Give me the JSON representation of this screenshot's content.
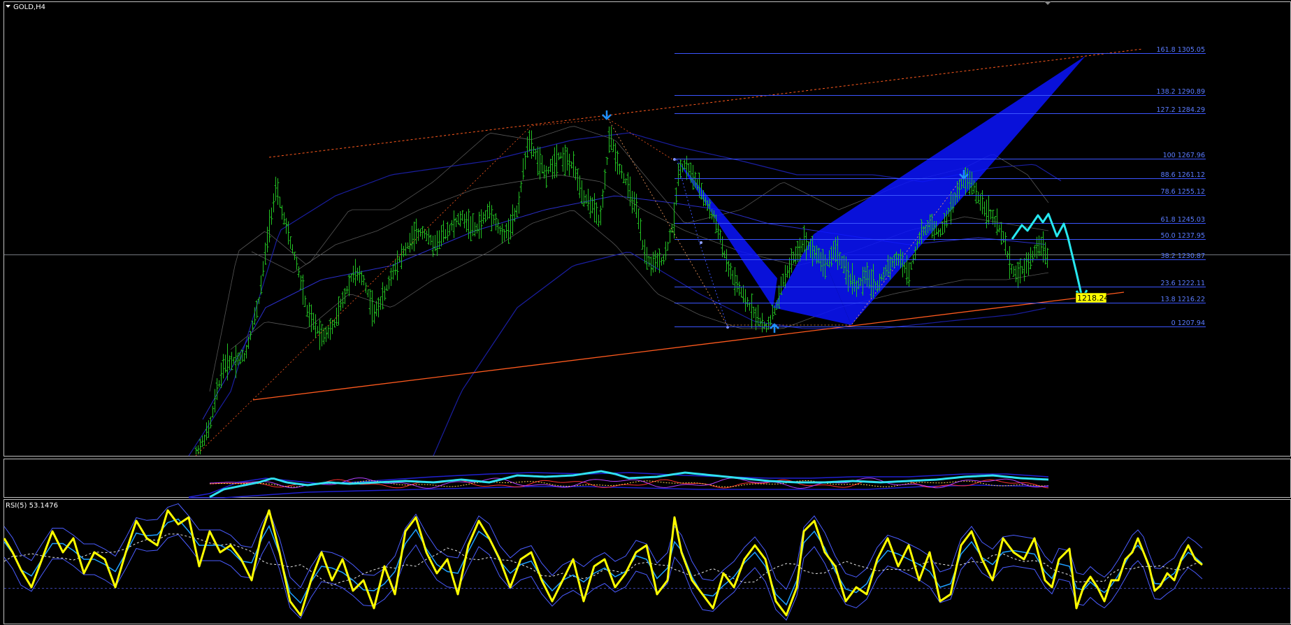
{
  "window": {
    "symbol_label": "GOLD,H4",
    "collapse_icon": "triangle-down-icon"
  },
  "colors": {
    "background": "#000000",
    "border": "#c0c0c0",
    "bull_bar": "#22c022",
    "fib_line": "#3b55ff",
    "fib_label": "#5b7cff",
    "pattern_fill": "#0a14ff",
    "channel": "#ff5a1e",
    "forecast": "#27e8f0",
    "rsi_main": "#ffff00",
    "price_tag": "#ffff00"
  },
  "fibonacci": {
    "levels": [
      {
        "ratio": "161.8",
        "price": "1305.05"
      },
      {
        "ratio": "138.2",
        "price": "1290.89"
      },
      {
        "ratio": "127.2",
        "price": "1284.29"
      },
      {
        "ratio": "100",
        "price": "1267.96"
      },
      {
        "ratio": "88.6",
        "price": "1261.12"
      },
      {
        "ratio": "78.6",
        "price": "1255.12"
      },
      {
        "ratio": "61.8",
        "price": "1245.03"
      },
      {
        "ratio": "50.0",
        "price": "1237.95"
      },
      {
        "ratio": "38.2",
        "price": "1230.87"
      },
      {
        "ratio": "23.6",
        "price": "1222.11"
      },
      {
        "ratio": "13.8",
        "price": "1216.22"
      },
      {
        "ratio": "0",
        "price": "1207.94"
      }
    ]
  },
  "price_tag": "1218.24",
  "indicators": {
    "middle_panel": "oscillator",
    "rsi_label": "RSI(5) 53.1476"
  }
}
